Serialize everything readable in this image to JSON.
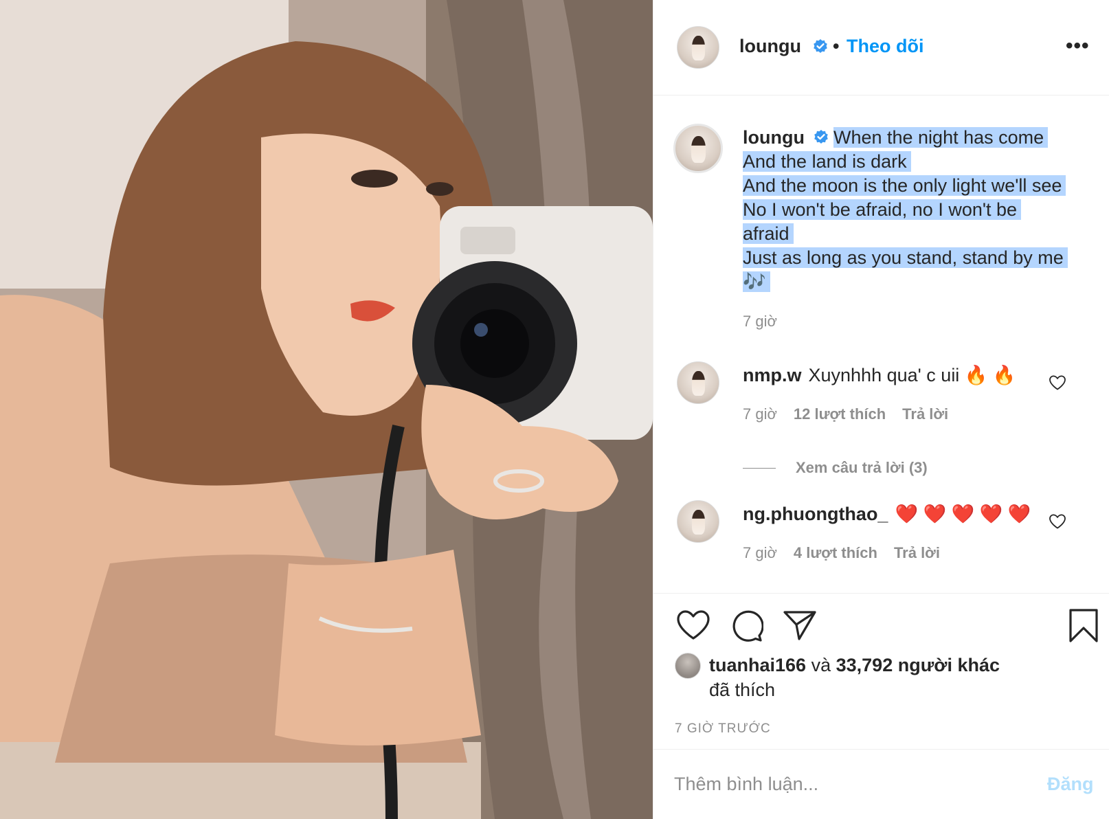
{
  "post": {
    "username": "loungu",
    "separator": "•",
    "follow_label": "Theo dõi",
    "more_label": "•••"
  },
  "caption": {
    "username": "loungu",
    "lines": [
      "When the night has come",
      "And the land is dark",
      "And the moon is the only light we'll see",
      "No I won't be afraid, no I won't be",
      "afraid",
      "Just as long as you stand, stand by me",
      "🎶"
    ],
    "time": "7 giờ"
  },
  "comments": [
    {
      "username": "nmp.w",
      "text": "Xuynhhh qua' c uii 🔥 🔥",
      "time": "7 giờ",
      "likes": "12 lượt thích",
      "reply": "Trả lời",
      "view_replies": "Xem câu trả lời (3)"
    },
    {
      "username": "ng.phuongthao_",
      "text": "❤️ ❤️ ❤️ ❤️ ❤️",
      "time": "7 giờ",
      "likes": "4 lượt thích",
      "reply": "Trả lời"
    }
  ],
  "likes": {
    "first_liker": "tuanhai166",
    "and": "và",
    "others": "33,792 người khác",
    "suffix": "đã thích"
  },
  "post_time": "7 GIỜ TRƯỚC",
  "add_comment": {
    "placeholder": "Thêm bình luận...",
    "post_label": "Đăng"
  },
  "colors": {
    "accent": "#0095f6",
    "secondary_text": "#8e8e8e",
    "selection": "#b4d5fe",
    "post_disabled": "#b2dffc"
  },
  "icons": [
    "verified-badge-icon",
    "more-options-icon",
    "heart-icon",
    "comment-icon",
    "share-icon",
    "bookmark-icon"
  ]
}
